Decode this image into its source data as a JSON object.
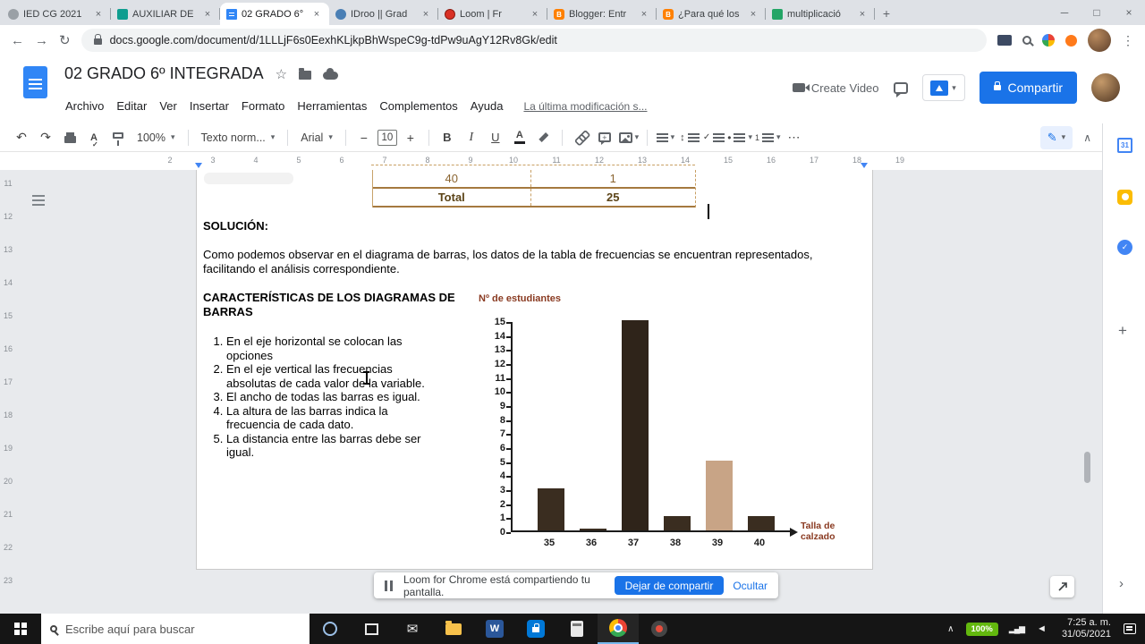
{
  "browser": {
    "tabs": [
      {
        "label": "IED CG 2021",
        "icon": "globe-favicon",
        "active": false
      },
      {
        "label": "AUXILIAR DE",
        "icon": "excel-favicon",
        "active": false
      },
      {
        "label": "02 GRADO 6°",
        "icon": "docs-favicon",
        "active": true
      },
      {
        "label": "IDroo || Grad",
        "icon": "idroo-favicon",
        "active": false
      },
      {
        "label": "Loom | Fr",
        "icon": "loom-favicon",
        "active": false
      },
      {
        "label": "Blogger: Entr",
        "icon": "blogger-favicon",
        "active": false
      },
      {
        "label": "¿Para qué los",
        "icon": "blogger-favicon",
        "active": false
      },
      {
        "label": "multiplicació",
        "icon": "sheets-favicon",
        "active": false
      }
    ],
    "url": "docs.google.com/document/d/1LLLjF6s0EexhKLjkpBhWspeC9g-tdPw9uAgY12Rv8Gk/edit"
  },
  "docs": {
    "title": "02 GRADO 6º  INTEGRADA",
    "menus": [
      "Archivo",
      "Editar",
      "Ver",
      "Insertar",
      "Formato",
      "Herramientas",
      "Complementos",
      "Ayuda"
    ],
    "last_modified": "La última modificación s...",
    "create_video_label": "Create Video",
    "share_label": "Compartir",
    "toolbar": {
      "zoom": "100%",
      "paragraph_style": "Texto norm...",
      "font": "Arial",
      "font_size": "10"
    }
  },
  "ruler": {
    "horizontal_numbers": [
      2,
      3,
      4,
      5,
      6,
      7,
      8,
      9,
      10,
      11,
      12,
      13,
      14,
      15,
      16,
      17,
      18,
      19
    ],
    "vertical_numbers": [
      11,
      12,
      13,
      14,
      15,
      16,
      17,
      18,
      19,
      20,
      21,
      22,
      23
    ]
  },
  "document": {
    "table": {
      "rows": [
        {
          "cells": [
            "40",
            "1"
          ],
          "bold": false
        },
        {
          "cells": [
            "Total",
            "25"
          ],
          "bold": true
        }
      ]
    },
    "solution_heading": "SOLUCIÓN:",
    "intro_paragraph": "Como podemos observar en el diagrama de barras, los datos de la tabla de frecuencias se encuentran representados, facilitando el análisis correspondiente.",
    "characteristics_heading": "CARACTERÍSTICAS DE LOS DIAGRAMAS DE BARRAS",
    "characteristics_list": [
      "En el eje horizontal se colocan las opciones",
      "En el eje vertical las frecuencias absolutas de cada valor de la variable.",
      "El ancho de todas las barras es igual.",
      "La altura de las barras indica la frecuencia de cada dato.",
      "La distancia entre las barras debe ser igual."
    ]
  },
  "chart_data": {
    "type": "bar",
    "categories": [
      "35",
      "36",
      "37",
      "38",
      "39",
      "40"
    ],
    "values": [
      3,
      0,
      15,
      1,
      5,
      1
    ],
    "ylabel": "Nº de estudiantes",
    "xlabel": "Talla de calzado",
    "ylim": [
      0,
      15
    ],
    "ytick_step": 1,
    "grid": false,
    "bar_colors": [
      "#3a2d20",
      "#3a2d20",
      "#2f241a",
      "#3a2d20",
      "#c8a486",
      "#3a2d20"
    ],
    "axis_label_color": "#8a3b22"
  },
  "loom_bar": {
    "message": "Loom for Chrome está compartiendo tu pantalla.",
    "stop_button": "Dejar de compartir",
    "hide_button": "Ocultar"
  },
  "side_panel": {
    "calendar_day": "31"
  },
  "taskbar": {
    "search_placeholder": "Escribe aquí para buscar",
    "apps": [
      {
        "name": "cortana",
        "active": false
      },
      {
        "name": "task-view",
        "active": false
      },
      {
        "name": "mail",
        "active": false
      },
      {
        "name": "file-explorer",
        "active": false
      },
      {
        "name": "word",
        "active": false
      },
      {
        "name": "store",
        "active": false
      },
      {
        "name": "calculator",
        "active": false
      },
      {
        "name": "chrome",
        "active": true
      },
      {
        "name": "screen-recorder",
        "active": false
      }
    ],
    "battery_label": "100%",
    "clock_time": "7:25 a. m.",
    "clock_date": "31/05/2021"
  }
}
